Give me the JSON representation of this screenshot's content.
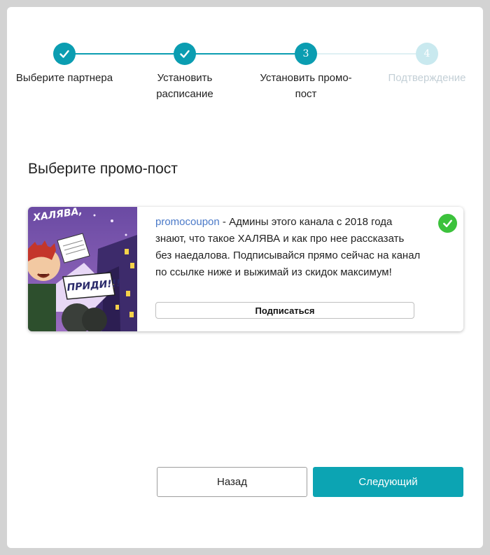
{
  "stepper": {
    "steps": [
      {
        "label": "Выберите партнера",
        "state": "done",
        "number": "1"
      },
      {
        "label": "Установить расписание",
        "state": "done",
        "number": "2"
      },
      {
        "label": "Установить промо-пост",
        "state": "active",
        "number": "3"
      },
      {
        "label": "Подтверждение",
        "state": "todo",
        "number": "4"
      }
    ]
  },
  "section": {
    "title": "Выберите промо-пост"
  },
  "post": {
    "channel": "promocoupon",
    "text": " - Админы этого канала с 2018 года знают, что такое ХАЛЯВА и как про нее рассказать без наедалова. Подписывайся прямо сейчас на канал по ссылке ниже и выжимай из скидок максимум!",
    "subscribe_label": "Подписаться",
    "image_caption_top": "ХАЛЯВА,",
    "image_caption_bubble": "ПРИДИ!!!",
    "selected": true
  },
  "footer": {
    "back_label": "Назад",
    "next_label": "Следующий"
  },
  "colors": {
    "accent": "#0b9db1",
    "next_button": "#0ca4b3",
    "selected_check": "#3cc23c",
    "step_todo": "#c9e9ef",
    "link": "#4a79c8"
  },
  "icons": {
    "step_done": "checkmark-icon",
    "post_selected": "check-circle-icon"
  }
}
